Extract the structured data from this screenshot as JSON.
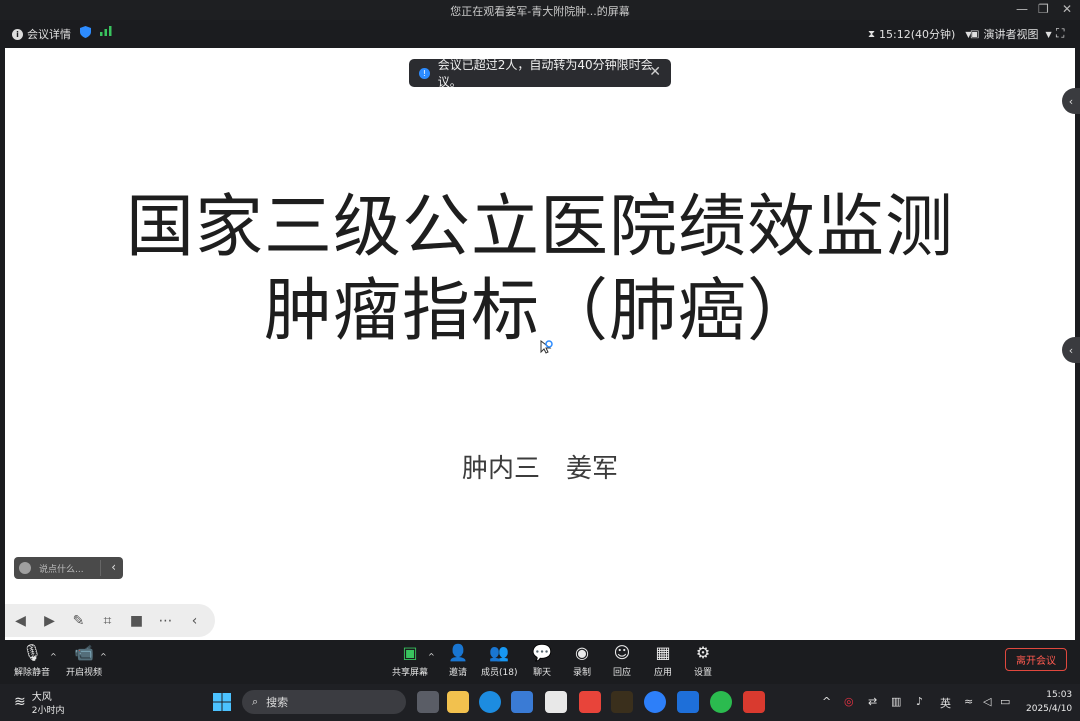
{
  "window": {
    "title": "您正在观看姜军-青大附院肿...的屏幕"
  },
  "infobar": {
    "meeting_details": "会议详情",
    "timer": "15:12(40分钟)",
    "view_mode": "演讲者视图"
  },
  "toast": {
    "message": "会议已超过2人，自动转为40分钟限时会议。"
  },
  "slide": {
    "title_line1": "国家三级公立医院绩效监测",
    "title_line2": "肿瘤指标（肺癌）",
    "subtitle": "肿内三　姜军"
  },
  "chat": {
    "placeholder": "说点什么..."
  },
  "toolbar": {
    "unmute": "解除静音",
    "start_video": "开启视频",
    "share_screen": "共享屏幕",
    "invite": "邀请",
    "members": "成员(18)",
    "chat": "聊天",
    "record": "录制",
    "replay": "回应",
    "apps": "应用",
    "settings": "设置",
    "leave": "离开会议"
  },
  "taskbar": {
    "weather_title": "大风",
    "weather_sub": "2小时内",
    "search": "搜索",
    "ime": "英",
    "time": "15:03",
    "date": "2025/4/10"
  },
  "colors": {
    "accent": "#2d8cff",
    "leave": "#e0483e"
  }
}
